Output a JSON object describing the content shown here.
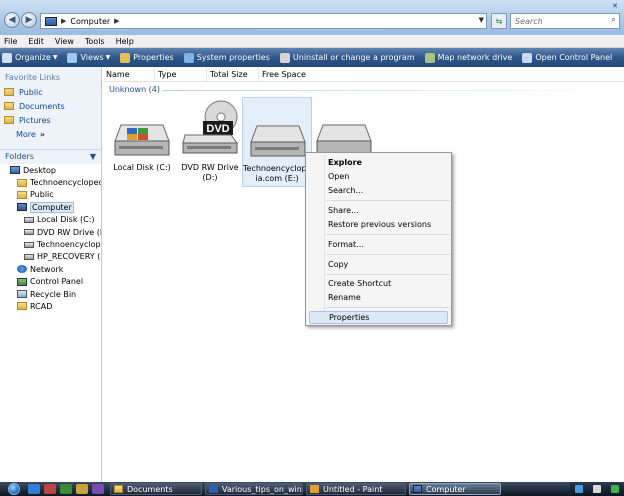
{
  "address": {
    "path": "Computer",
    "search_placeholder": "Search"
  },
  "menu": [
    "File",
    "Edit",
    "View",
    "Tools",
    "Help"
  ],
  "toolbar": {
    "organize": "Organize",
    "views": "Views",
    "properties": "Properties",
    "system_properties": "System properties",
    "uninstall": "Uninstall or change a program",
    "map_drive": "Map network drive",
    "control_panel": "Open Control Panel"
  },
  "sidebar": {
    "favorite_links_title": "Favorite Links",
    "favorites": [
      "Public",
      "Documents",
      "Pictures"
    ],
    "more": "More",
    "folders_title": "Folders",
    "tree": [
      "Desktop",
      "Technoencyclopedi",
      "Public",
      "Computer",
      "Local Disk (C:)",
      "DVD RW Drive (D:)",
      "Technoencyclope",
      "HP_RECOVERY (F:",
      "Network",
      "Control Panel",
      "Recycle Bin",
      "RCAD"
    ]
  },
  "columns": [
    "Name",
    "Type",
    "Total Size",
    "Free Space"
  ],
  "group_label": "Unknown (4)",
  "drives": [
    {
      "label": "Local Disk (C:)"
    },
    {
      "label": "DVD RW Drive (D:)",
      "badge": "DVD"
    },
    {
      "label": "Technoencyclope­ia.com (E:)",
      "label_line1": "Technoencyclope",
      "label_line2": "ia.com (E:)"
    },
    {
      "label": ""
    }
  ],
  "context_menu": {
    "explore": "Explore",
    "open": "Open",
    "search": "Search...",
    "share": "Share...",
    "restore": "Restore previous versions",
    "format": "Format...",
    "copy": "Copy",
    "create_shortcut": "Create Shortcut",
    "rename": "Rename",
    "properties": "Properties"
  },
  "taskbar": {
    "items": [
      "Documents",
      "Various_tips_on_win...",
      "Untitled - Paint",
      "Computer"
    ]
  },
  "colors": {
    "accent": "#2f5689",
    "selection": "#e3eefb",
    "link": "#0b49a8"
  }
}
